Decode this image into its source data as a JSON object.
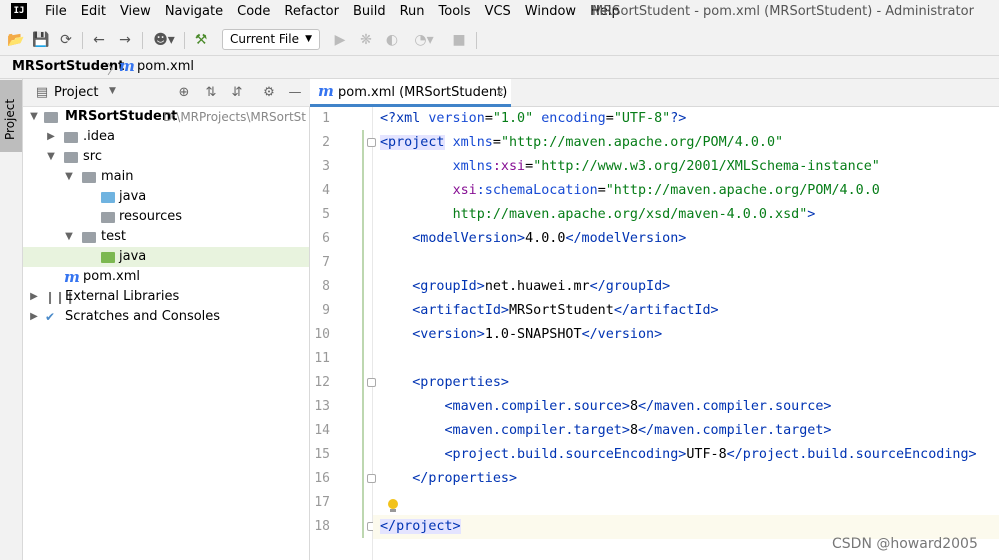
{
  "menubar": {
    "logo": "IJ",
    "items": [
      "File",
      "Edit",
      "View",
      "Navigate",
      "Code",
      "Refactor",
      "Build",
      "Run",
      "Tools",
      "VCS",
      "Window",
      "Help"
    ],
    "window_title": "MRSortStudent - pom.xml (MRSortStudent) - Administrator"
  },
  "toolbar": {
    "run_config": "Current File"
  },
  "breadcrumb": {
    "project": "MRSortStudent",
    "file": "pom.xml"
  },
  "left_stripe": {
    "project_tab": "Project"
  },
  "project_panel": {
    "title": "Project",
    "tree": [
      {
        "label": "MRSortStudent",
        "path": "D:\\MRProjects\\MRSortSt"
      },
      {
        "label": ".idea"
      },
      {
        "label": "src"
      },
      {
        "label": "main"
      },
      {
        "label": "java"
      },
      {
        "label": "resources"
      },
      {
        "label": "test"
      },
      {
        "label": "java"
      },
      {
        "label": "pom.xml"
      },
      {
        "label": "External Libraries"
      },
      {
        "label": "Scratches and Consoles"
      }
    ]
  },
  "editor": {
    "tab_label": "pom.xml (MRSortStudent)",
    "line_numbers": [
      "1",
      "2",
      "3",
      "4",
      "5",
      "6",
      "7",
      "8",
      "9",
      "10",
      "11",
      "12",
      "13",
      "14",
      "15",
      "16",
      "17",
      "18"
    ]
  },
  "watermark": "CSDN @howard2005",
  "colors": {
    "tag": "#0033b3",
    "string": "#067d17",
    "namespace": "#871094",
    "selection": "#e8f3de",
    "tab_underline": "#4083c9"
  }
}
